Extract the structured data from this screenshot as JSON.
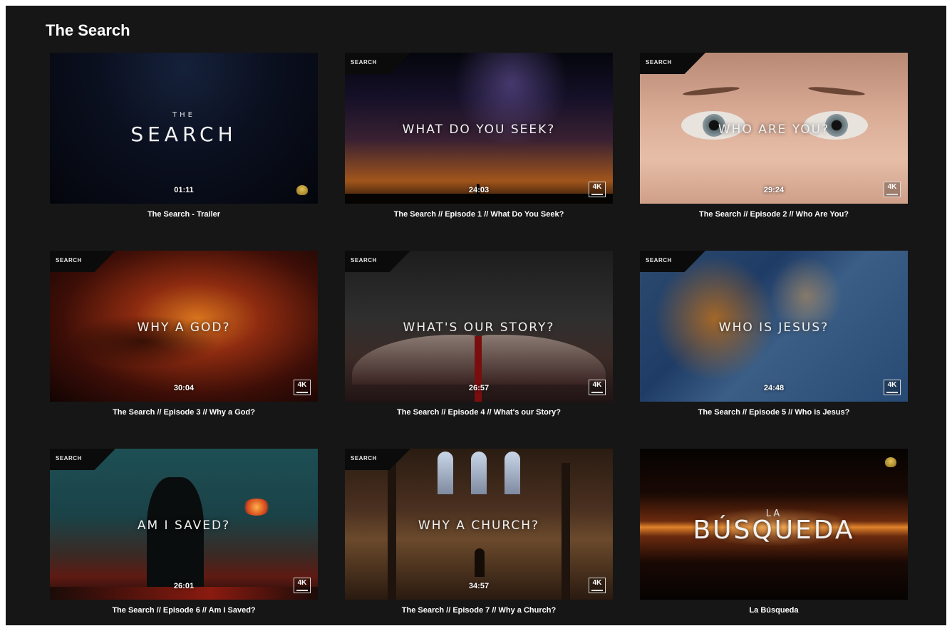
{
  "page": {
    "title": "The Search"
  },
  "videos": [
    {
      "caption": "The Search - Trailer",
      "duration": "01:11",
      "overlay_kicker": "THE",
      "overlay_title": "SEARCH",
      "icon": "gold-emblem-icon"
    },
    {
      "caption": "The Search // Episode 1 // What Do You Seek?",
      "duration": "24:03",
      "corner_label": "SEARCH",
      "overlay_title": "WHAT DO YOU SEEK?",
      "badge": "4K"
    },
    {
      "caption": "The Search // Episode 2 // Who Are You?",
      "duration": "29:24",
      "corner_label": "SEARCH",
      "overlay_title": "WHO ARE YOU?",
      "badge": "4K"
    },
    {
      "caption": "The Search // Episode 3 // Why a God?",
      "duration": "30:04",
      "corner_label": "SEARCH",
      "overlay_title": "WHY A GOD?",
      "badge": "4K"
    },
    {
      "caption": "The Search // Episode 4 // What's our Story?",
      "duration": "26:57",
      "corner_label": "SEARCH",
      "overlay_title": "WHAT'S OUR STORY?",
      "badge": "4K"
    },
    {
      "caption": "The Search // Episode 5 // Who is Jesus?",
      "duration": "24:48",
      "corner_label": "SEARCH",
      "overlay_title": "WHO IS JESUS?",
      "badge": "4K"
    },
    {
      "caption": "The Search // Episode 6 // Am I Saved?",
      "duration": "26:01",
      "corner_label": "SEARCH",
      "overlay_title": "AM I SAVED?",
      "badge": "4K"
    },
    {
      "caption": "The Search // Episode 7 // Why a Church?",
      "duration": "34:57",
      "corner_label": "SEARCH",
      "overlay_title": "WHY A CHURCH?",
      "badge": "4K"
    },
    {
      "caption": "La Búsqueda",
      "overlay_kicker": "LA",
      "overlay_title": "BÚSQUEDA",
      "icon": "gold-emblem-icon"
    }
  ],
  "colors": {
    "background": "#161616",
    "text": "#ffffff"
  }
}
